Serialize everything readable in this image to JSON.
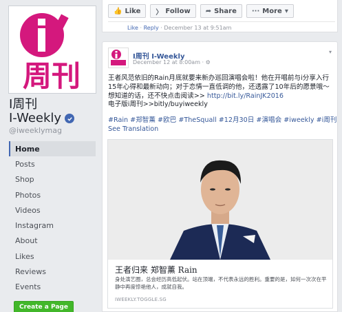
{
  "page": {
    "logo_text": "i",
    "logo_chars": "周刊",
    "logo_vertical": "weekly",
    "name_line1": "I周刊",
    "name_line2": "I-Weekly",
    "handle": "@iweeklymag",
    "brand_color": "#d4187d",
    "accent_color": "#4267b2"
  },
  "nav": {
    "items": [
      {
        "label": "Home",
        "active": true
      },
      {
        "label": "Posts"
      },
      {
        "label": "Shop"
      },
      {
        "label": "Photos"
      },
      {
        "label": "Videos"
      },
      {
        "label": "Instagram"
      },
      {
        "label": "About"
      },
      {
        "label": "Likes"
      },
      {
        "label": "Reviews"
      },
      {
        "label": "Events"
      }
    ],
    "create_page": "Create a Page"
  },
  "top_actions": {
    "like": "Like",
    "follow": "Follow",
    "share": "Share",
    "more": "More"
  },
  "reply_line": {
    "like": "Like",
    "sep": " · ",
    "reply": "Reply",
    "date": " · December 13 at 9:51am"
  },
  "post": {
    "author": "I周刊 I-Weekly",
    "meta": "December 12 at 8:00am · ",
    "text_part1": "王者风范依旧的Rain月底就要来新办巡回演唱会啦！他在开唱前与i分享入行15年心得和最新动向；对于恋情一直低调的他，还透露了10年后的愿景哦～想知道的话，还不快点击阅读>> ",
    "link1": "http://bit.ly/RainJK2016",
    "text_part2": "电子版i周刊>>bitly/buyiweekly",
    "tags": "#Rain #郑智薰 #欧巴 #TheSquall #12月30日 #演唱会 #iweekly #i周刊",
    "see_translation": "See Translation"
  },
  "link_card": {
    "title": "王者归来 郑智薰 Rain",
    "description": "身处演艺圈，总会经历高低起伏。站在顶端，不代表永远的胜利。重要的是，如何一次次在平静中再度惊艳他人，成就自我。",
    "domain": "IWEEKLY.TOGGLE.SG"
  }
}
